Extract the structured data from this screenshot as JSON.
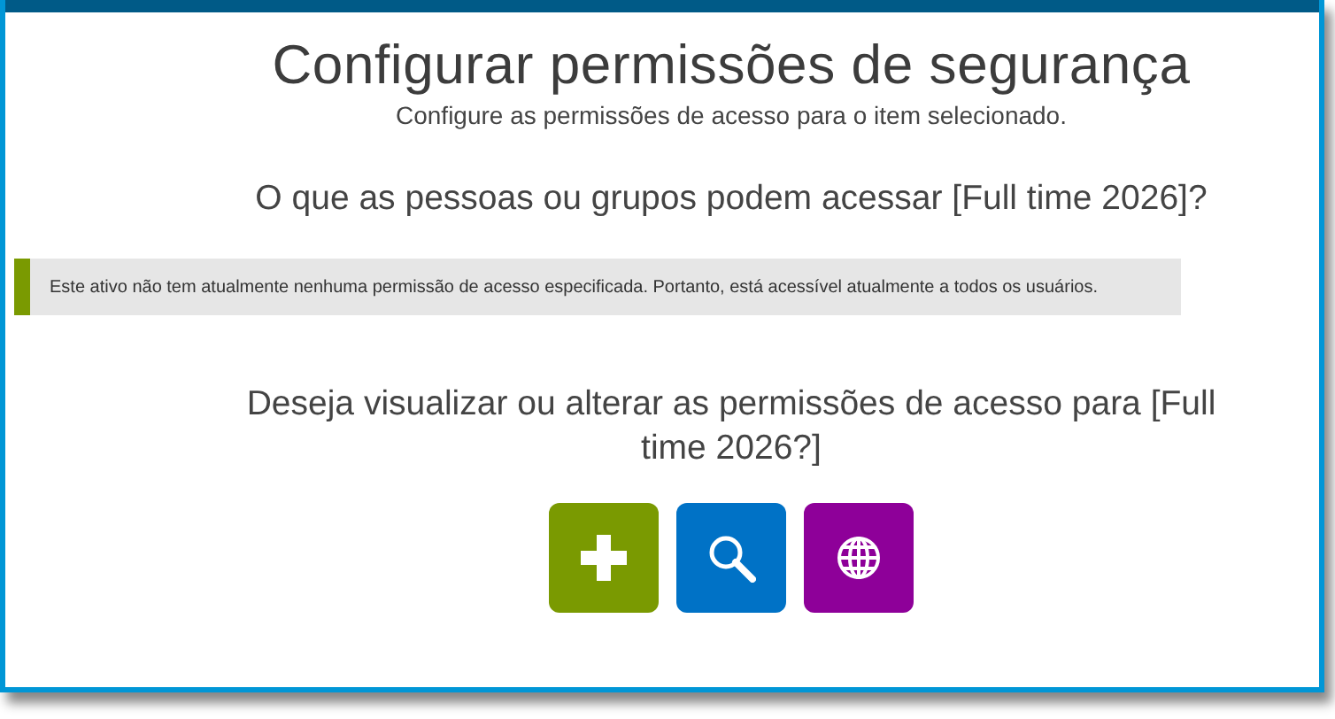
{
  "title": "Configurar permissões de segurança",
  "subtitle": "Configure as permissões de acesso para o item selecionado.",
  "question": "O que as pessoas ou grupos podem acessar [Full time 2026]?",
  "notice": "Este ativo não tem atualmente nenhuma permissão de acesso especificada. Portanto, está acessível atualmente a todos os usuários.",
  "prompt": "Deseja visualizar ou alterar as permissões de acesso para [Full time 2026?]",
  "buttons": [
    {
      "kind": "add",
      "color": "#7a9a01"
    },
    {
      "kind": "search",
      "color": "#0072c6"
    },
    {
      "kind": "globe",
      "color": "#8e0099"
    }
  ]
}
